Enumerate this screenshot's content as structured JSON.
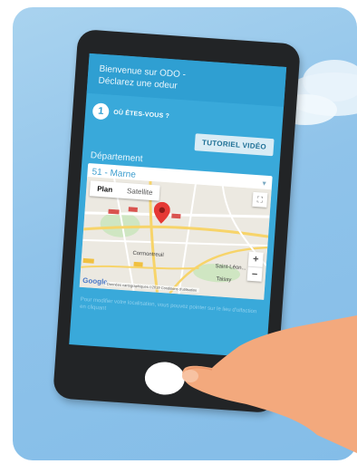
{
  "header": {
    "line1": "Bienvenue sur ODO -",
    "line2": "Déclarez une odeur"
  },
  "step": {
    "number": "1",
    "label": "OÙ ÊTES-VOUS ?"
  },
  "tutorial_button": "TUTORIEL VIDÉO",
  "department": {
    "label": "Département",
    "selected": "51 - Marne"
  },
  "map": {
    "tab_plan": "Plan",
    "tab_satellite": "Satellite",
    "zoom_in": "+",
    "zoom_out": "−",
    "places": {
      "cormontreuil": "Cormontreuil",
      "saint_leonard": "Saint-Léon...",
      "taissy": "Taissy"
    },
    "google_logo": "Google",
    "attribution": "Données cartographiques ©2019   Conditions d'utilisation",
    "colors": {
      "pin": "#e53935",
      "road_major": "#f7d46a",
      "road_minor": "#ffffff",
      "park": "#cfe6c2"
    }
  },
  "hint_text": "Pour modifier votre localisation, vous pouvez pointer sur le lieu d'olfaction en cliquant",
  "colors": {
    "sky": "#8fc3ea",
    "screen": "#39a9da",
    "header": "#2f9fd2",
    "phone": "#222426",
    "skin": "#f3a97d"
  }
}
